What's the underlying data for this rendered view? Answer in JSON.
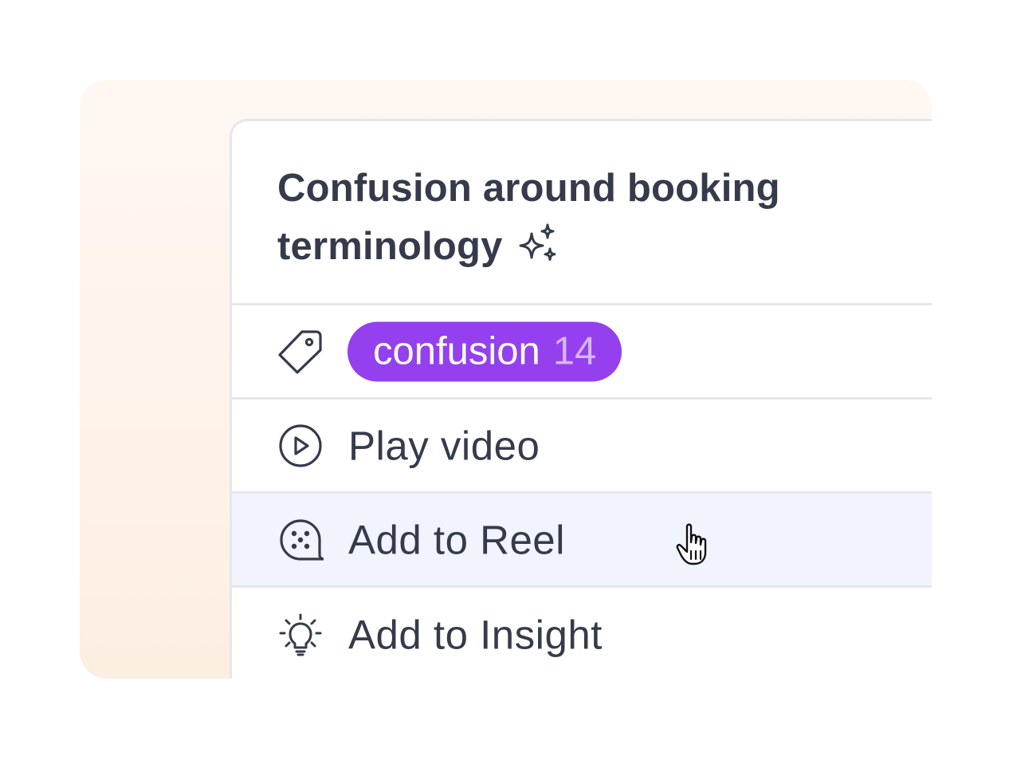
{
  "card": {
    "title": "Confusion around booking terminology",
    "title_icon": "sparkles-icon"
  },
  "tag_row": {
    "icon": "tag-icon",
    "tag": {
      "label": "confusion",
      "count": "14",
      "color": "#9440ee"
    }
  },
  "menu": {
    "items": [
      {
        "label": "Play video",
        "icon": "play-circle-icon"
      },
      {
        "label": "Add to Reel",
        "icon": "film-reel-icon",
        "hovered": true
      },
      {
        "label": "Add to Insight",
        "icon": "lightbulb-icon"
      }
    ]
  },
  "colors": {
    "text": "#353b4b",
    "divider": "#e5e7ee",
    "hover_row": "#f1f3fd",
    "backdrop_top": "#fff8f2",
    "backdrop_bottom": "#fdeee2"
  },
  "pointer": "hand-pointer-icon"
}
